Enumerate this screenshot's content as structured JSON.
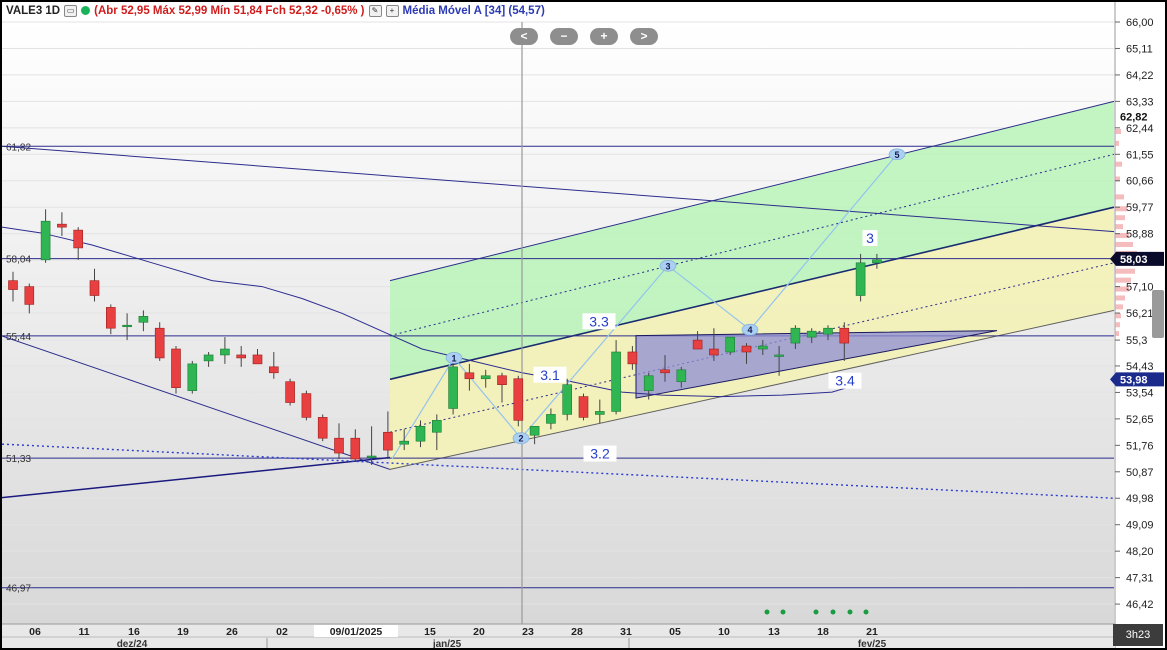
{
  "header": {
    "symbol": "VALE3 1D",
    "quote": "(Abr 52,95 Máx 52,99 Mín 51,84 Fch 52,32 -0,65% )",
    "indicator": "Média Móvel A [34] (54,57)"
  },
  "nav": [
    "<",
    "−",
    "+",
    ">"
  ],
  "timer": "3h23",
  "colors": {
    "up": "#2fb552",
    "down": "#e84040",
    "channel_green": "#b9f5b9",
    "channel_yellow": "#f3f1b6",
    "triangle": "#8e8ed6",
    "line": "#2c2c8c",
    "price_badge": "#1a2b8c"
  },
  "chart_data": {
    "type": "candlestick",
    "y_ticks": [
      "66,00",
      "65,11",
      "64,22",
      "63,33",
      "62,44",
      "61,55",
      "60,66",
      "59,77",
      "58,88",
      "57,99",
      "57,10",
      "56,21",
      "55,3",
      "54,43",
      "53,54",
      "52,65",
      "51,76",
      "50,87",
      "49,98",
      "49,09",
      "48,20",
      "47,31",
      "46,42"
    ],
    "ylim": [
      45.75,
      66.0
    ],
    "x_ticks": [
      "06",
      "11",
      "16",
      "19",
      "26",
      "02",
      "09/01/2025",
      "15",
      "20",
      "23",
      "28",
      "31",
      "05",
      "10",
      "13",
      "18",
      "21"
    ],
    "month_labels": [
      "dez/24",
      "jan/25",
      "fev/25"
    ],
    "price_labels": [
      {
        "text": "62,82",
        "value": 62.82,
        "style": "plain"
      },
      {
        "text": "58,03",
        "value": 58.03,
        "style": "dark"
      },
      {
        "text": "53,98",
        "value": 53.98,
        "style": "blue"
      }
    ],
    "horizontal_levels": [
      {
        "label": "61,82",
        "value": 61.82
      },
      {
        "label": "58,04",
        "value": 58.04
      },
      {
        "label": "55,44",
        "value": 55.44
      },
      {
        "label": "51,33",
        "value": 51.33
      },
      {
        "label": "46,97",
        "value": 46.97
      }
    ],
    "candles": [
      {
        "o": 57.3,
        "h": 57.6,
        "l": 56.6,
        "c": 57.0
      },
      {
        "o": 57.1,
        "h": 57.2,
        "l": 56.2,
        "c": 56.5
      },
      {
        "o": 58.0,
        "h": 59.7,
        "l": 57.9,
        "c": 59.3
      },
      {
        "o": 59.2,
        "h": 59.6,
        "l": 58.8,
        "c": 59.1
      },
      {
        "o": 59.0,
        "h": 59.1,
        "l": 58.0,
        "c": 58.4
      },
      {
        "o": 57.3,
        "h": 57.7,
        "l": 56.6,
        "c": 56.8
      },
      {
        "o": 56.4,
        "h": 56.5,
        "l": 55.5,
        "c": 55.7
      },
      {
        "o": 55.8,
        "h": 56.2,
        "l": 55.3,
        "c": 55.8
      },
      {
        "o": 55.9,
        "h": 56.3,
        "l": 55.6,
        "c": 56.1
      },
      {
        "o": 55.7,
        "h": 55.9,
        "l": 54.6,
        "c": 54.7
      },
      {
        "o": 55.0,
        "h": 55.1,
        "l": 53.5,
        "c": 53.7
      },
      {
        "o": 53.6,
        "h": 54.6,
        "l": 53.5,
        "c": 54.5
      },
      {
        "o": 54.6,
        "h": 54.9,
        "l": 54.4,
        "c": 54.8
      },
      {
        "o": 54.8,
        "h": 55.4,
        "l": 54.5,
        "c": 55.0
      },
      {
        "o": 54.8,
        "h": 55.1,
        "l": 54.4,
        "c": 54.7
      },
      {
        "o": 54.8,
        "h": 55.0,
        "l": 54.5,
        "c": 54.5
      },
      {
        "o": 54.4,
        "h": 54.9,
        "l": 54.0,
        "c": 54.2
      },
      {
        "o": 53.9,
        "h": 54.0,
        "l": 53.1,
        "c": 53.2
      },
      {
        "o": 53.5,
        "h": 53.6,
        "l": 52.6,
        "c": 52.7
      },
      {
        "o": 52.7,
        "h": 52.8,
        "l": 51.9,
        "c": 52.0
      },
      {
        "o": 52.0,
        "h": 52.5,
        "l": 51.3,
        "c": 51.5
      },
      {
        "o": 52.0,
        "h": 52.3,
        "l": 51.2,
        "c": 51.3
      },
      {
        "o": 51.4,
        "h": 52.4,
        "l": 51.1,
        "c": 51.4
      },
      {
        "o": 52.2,
        "h": 52.9,
        "l": 51.3,
        "c": 51.6
      },
      {
        "o": 51.8,
        "h": 52.3,
        "l": 51.6,
        "c": 51.9
      },
      {
        "o": 51.9,
        "h": 52.6,
        "l": 51.7,
        "c": 52.4
      },
      {
        "o": 52.2,
        "h": 52.8,
        "l": 51.6,
        "c": 52.6
      },
      {
        "o": 53.0,
        "h": 54.5,
        "l": 52.8,
        "c": 54.4
      },
      {
        "o": 54.2,
        "h": 54.5,
        "l": 53.6,
        "c": 54.0
      },
      {
        "o": 54.0,
        "h": 54.3,
        "l": 53.7,
        "c": 54.1
      },
      {
        "o": 54.1,
        "h": 54.2,
        "l": 53.2,
        "c": 53.8
      },
      {
        "o": 54.0,
        "h": 54.1,
        "l": 52.4,
        "c": 52.6
      },
      {
        "o": 52.1,
        "h": 52.4,
        "l": 51.8,
        "c": 52.4
      },
      {
        "o": 52.5,
        "h": 53.0,
        "l": 52.3,
        "c": 52.8
      },
      {
        "o": 52.8,
        "h": 54.0,
        "l": 52.6,
        "c": 53.8
      },
      {
        "o": 53.4,
        "h": 53.5,
        "l": 52.6,
        "c": 52.7
      },
      {
        "o": 52.8,
        "h": 53.3,
        "l": 52.5,
        "c": 52.9
      },
      {
        "o": 52.9,
        "h": 55.3,
        "l": 52.8,
        "c": 54.9
      },
      {
        "o": 54.9,
        "h": 55.1,
        "l": 54.3,
        "c": 54.5
      },
      {
        "o": 53.6,
        "h": 54.2,
        "l": 53.3,
        "c": 54.1
      },
      {
        "o": 54.3,
        "h": 54.8,
        "l": 53.9,
        "c": 54.2
      },
      {
        "o": 53.9,
        "h": 54.4,
        "l": 53.7,
        "c": 54.3
      },
      {
        "o": 55.3,
        "h": 55.6,
        "l": 55.0,
        "c": 55.0
      },
      {
        "o": 55.0,
        "h": 55.7,
        "l": 54.6,
        "c": 54.8
      },
      {
        "o": 54.9,
        "h": 55.4,
        "l": 54.8,
        "c": 55.4
      },
      {
        "o": 55.1,
        "h": 55.2,
        "l": 54.5,
        "c": 54.9
      },
      {
        "o": 55.0,
        "h": 55.3,
        "l": 54.8,
        "c": 55.1
      },
      {
        "o": 54.8,
        "h": 55.1,
        "l": 54.1,
        "c": 54.8
      },
      {
        "o": 55.2,
        "h": 55.8,
        "l": 55.0,
        "c": 55.7
      },
      {
        "o": 55.4,
        "h": 55.7,
        "l": 55.2,
        "c": 55.6
      },
      {
        "o": 55.5,
        "h": 55.8,
        "l": 55.3,
        "c": 55.7
      },
      {
        "o": 55.7,
        "h": 55.9,
        "l": 54.6,
        "c": 55.2
      },
      {
        "o": 56.8,
        "h": 58.2,
        "l": 56.6,
        "c": 57.9
      },
      {
        "o": 57.9,
        "h": 58.2,
        "l": 57.7,
        "c": 58.0
      }
    ],
    "wave_labels": [
      {
        "text": "1",
        "pill": true
      },
      {
        "text": "2",
        "pill": true
      },
      {
        "text": "3",
        "pill": true
      },
      {
        "text": "4",
        "pill": true
      },
      {
        "text": "5",
        "pill": true
      },
      {
        "text": "3",
        "pill": false
      },
      {
        "text": "3.1",
        "pill": false
      },
      {
        "text": "3.2",
        "pill": false
      },
      {
        "text": "3.3",
        "pill": false
      },
      {
        "text": "3.4",
        "pill": false
      }
    ]
  }
}
